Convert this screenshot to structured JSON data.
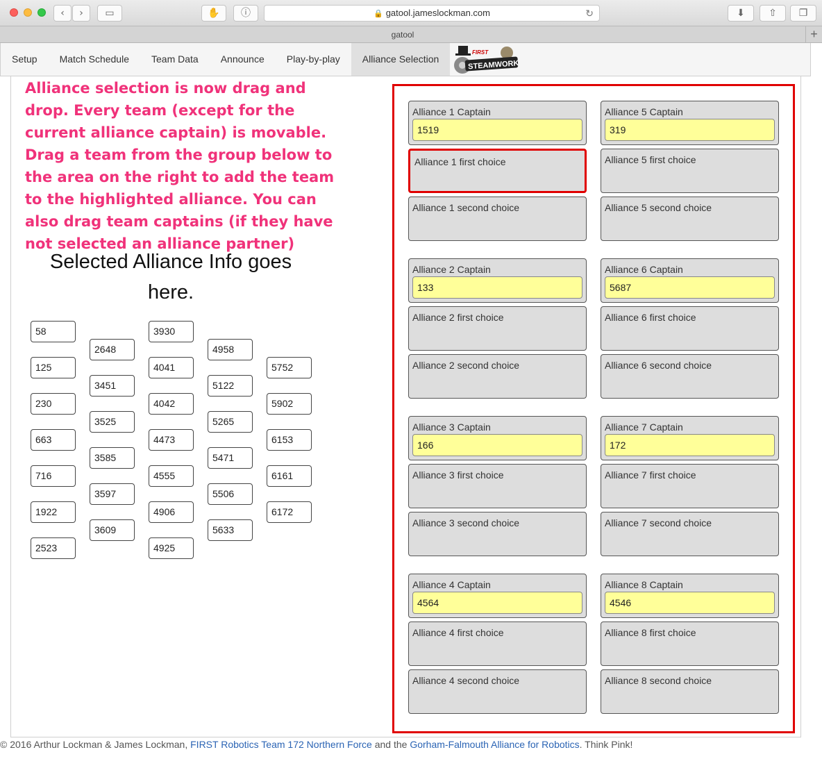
{
  "browser": {
    "url": "gatool.jameslockman.com",
    "tab_title": "gatool"
  },
  "nav": {
    "items": [
      "Setup",
      "Match Schedule",
      "Team Data",
      "Announce",
      "Play-by-play",
      "Alliance Selection"
    ],
    "active": "Alliance Selection",
    "logo_top": "FIRST",
    "logo_text": "STEAMWORKS"
  },
  "annotation": "Alliance selection is now drag and drop. Every team (except for the current alliance captain) is movable. Drag a team from the group below to the area on the right to add the team to the highlighted alliance. You can also drag team captains (if they have not selected an alliance partner)",
  "info_text": "Selected Alliance Info goes here.",
  "available_teams": [
    [
      "58",
      "125",
      "230",
      "663",
      "716",
      "1922",
      "2523"
    ],
    [
      "2648",
      "3451",
      "3525",
      "3585",
      "3597",
      "3609"
    ],
    [
      "3930",
      "4041",
      "4042",
      "4473",
      "4555",
      "4906",
      "4925"
    ],
    [
      "4958",
      "5122",
      "5265",
      "5471",
      "5506",
      "5633"
    ],
    [
      "5752",
      "5902",
      "6153",
      "6161",
      "6172"
    ]
  ],
  "alliances": [
    {
      "captain_label": "Alliance 1 Captain",
      "captain": "1519",
      "first_label": "Alliance 1 first choice",
      "second_label": "Alliance 1 second choice"
    },
    {
      "captain_label": "Alliance 2 Captain",
      "captain": "133",
      "first_label": "Alliance 2 first choice",
      "second_label": "Alliance 2 second choice"
    },
    {
      "captain_label": "Alliance 3 Captain",
      "captain": "166",
      "first_label": "Alliance 3 first choice",
      "second_label": "Alliance 3 second choice"
    },
    {
      "captain_label": "Alliance 4 Captain",
      "captain": "4564",
      "first_label": "Alliance 4 first choice",
      "second_label": "Alliance 4 second choice"
    },
    {
      "captain_label": "Alliance 5 Captain",
      "captain": "319",
      "first_label": "Alliance 5 first choice",
      "second_label": "Alliance 5 second choice"
    },
    {
      "captain_label": "Alliance 6 Captain",
      "captain": "5687",
      "first_label": "Alliance 6 first choice",
      "second_label": "Alliance 6 second choice"
    },
    {
      "captain_label": "Alliance 7 Captain",
      "captain": "172",
      "first_label": "Alliance 7 first choice",
      "second_label": "Alliance 7 second choice"
    },
    {
      "captain_label": "Alliance 8 Captain",
      "captain": "4546",
      "first_label": "Alliance 8 first choice",
      "second_label": "Alliance 8 second choice"
    }
  ],
  "highlighted_slot": "Alliance 1 first choice",
  "footer": {
    "prefix": "© 2016 Arthur Lockman & James Lockman, ",
    "link1": "FIRST Robotics Team 172 Northern Force",
    "middle": " and the ",
    "link2": "Gorham-Falmouth Alliance for Robotics",
    "suffix": ". Think Pink!"
  },
  "colors": {
    "annotation": "#f0327a",
    "highlight": "#e00000",
    "captain_bg": "#ffff99",
    "slot_bg": "#dddddd",
    "link": "#2b64b4"
  }
}
